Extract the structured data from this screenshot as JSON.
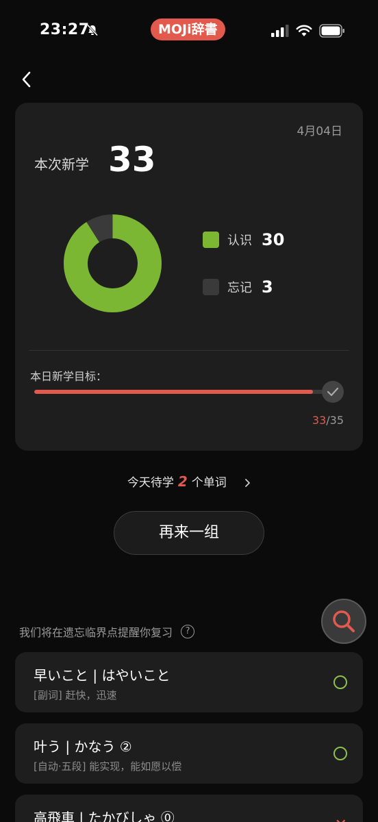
{
  "status_bar": {
    "time": "23:27",
    "app_badge": "MOJi辞書"
  },
  "card": {
    "date": "4月04日",
    "new_label": "本次新学",
    "new_count": "33",
    "legend": [
      {
        "label": "认识",
        "value": "30",
        "color": "#7cb733"
      },
      {
        "label": "忘记",
        "value": "3",
        "color": "#3a3a3a"
      }
    ],
    "goal_label": "本日新学目标：",
    "goal_done": "33",
    "goal_sep": "/",
    "goal_total": "35",
    "goal_progress": 0.943
  },
  "pending": {
    "prefix": "今天待学",
    "count": "2",
    "suffix": "个单词"
  },
  "again_button": "再来一组",
  "remind_text": "我们将在遗忘临界点提醒你复习",
  "help_icon": "?",
  "words": [
    {
      "title": "早いこと | はやいこと",
      "definition": "[副词] 赶快，迅速",
      "status": "known"
    },
    {
      "title": "叶う | かなう ②",
      "definition": "[自动·五段] 能实现，能如愿以偿",
      "status": "known"
    },
    {
      "title": "高飛車 | たかびしゃ ⓪",
      "definition": "",
      "status": "forgotten"
    }
  ],
  "colors": {
    "accent": "#e25a4e",
    "known": "#7cb733",
    "forgotten": "#3a3a3a"
  }
}
